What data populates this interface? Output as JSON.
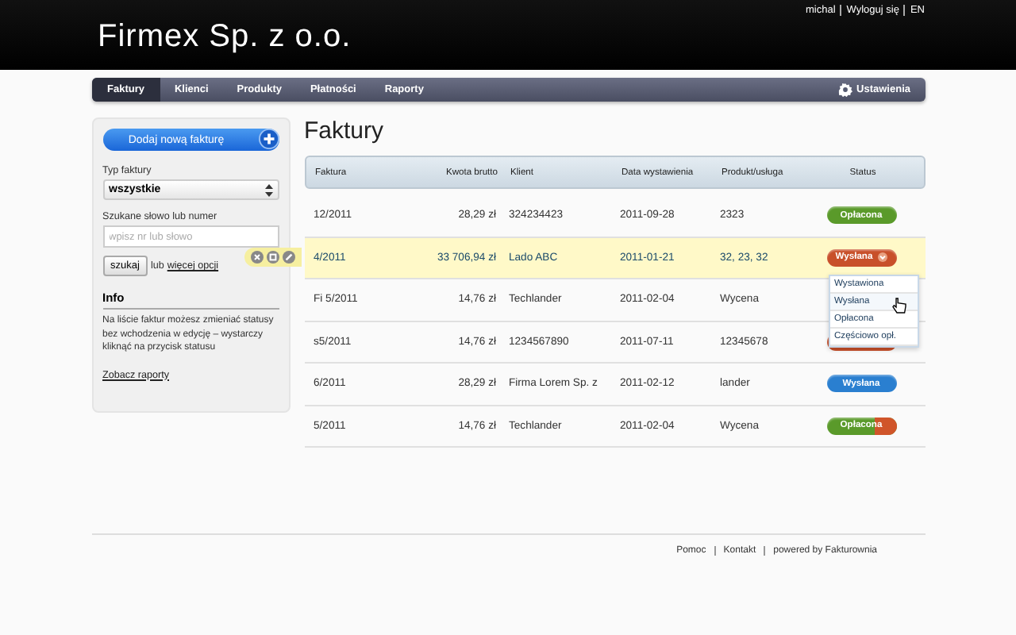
{
  "header": {
    "title": "Firmex Sp. z o.o.",
    "user_links": [
      "michal",
      "Wyloguj się",
      "EN"
    ]
  },
  "nav": {
    "items": [
      {
        "label": "Faktury",
        "selected": true
      },
      {
        "label": "Klienci",
        "selected": false
      },
      {
        "label": "Produkty",
        "selected": false
      },
      {
        "label": "Płatności",
        "selected": false
      },
      {
        "label": "Raporty",
        "selected": false
      }
    ],
    "settings": "Ustawienia"
  },
  "sidebar": {
    "add_button": "Dodaj nową fakturę",
    "type_label": "Typ faktury",
    "type_value": "wszystkie",
    "search_label": "Szukane słowo lub numer",
    "search_placeholder": "wpisz nr lub słowo",
    "search_button": "szukaj",
    "or_text": "lub",
    "more_link": "więcej opcji",
    "info_title": "Info",
    "info_text": "Na liście faktur możesz zmieniać statusy bez wchodzenia w edycję – wystarczy kliknąć na przycisk statusu",
    "report_link": "Zobacz raporty"
  },
  "main": {
    "title": "Faktury",
    "columns": [
      "Faktura",
      "Kwota brutto",
      "Klient",
      "Data wystawienia",
      "Produkt/usługa",
      "Status"
    ],
    "rows": [
      {
        "invoice": "12/2011",
        "amount": "28,29 zł",
        "client": "324234423",
        "date": "2011-09-28",
        "product": "2323",
        "highlighted": false,
        "status": {
          "label": "Opłacona",
          "color": "#5a9a2a"
        }
      },
      {
        "invoice": "4/2011",
        "amount": "33 706,94 zł",
        "client": "Lado ABC",
        "date": "2011-01-21",
        "product": "32, 23, 32",
        "highlighted": true,
        "status": {
          "label": "Wysłana",
          "color": "#c8502a",
          "open": true
        }
      },
      {
        "invoice": "Fi 5/2011",
        "amount": "14,76 zł",
        "client": "Techlander",
        "date": "2011-02-04",
        "product": "Wycena",
        "highlighted": false
      },
      {
        "invoice": "s5/2011",
        "amount": "14,76 zł",
        "client": "1234567890",
        "date": "2011-07-11",
        "product": "12345678",
        "highlighted": false,
        "status": {
          "color": "#c8502a"
        }
      },
      {
        "invoice": "6/2011",
        "amount": "28,29 zł",
        "client": "Firma Lorem Sp. z",
        "date": "2011-02-12",
        "product": "lander",
        "highlighted": false,
        "status": {
          "label": "Wysłana",
          "color": "#2a7fd0"
        }
      },
      {
        "invoice": "5/2011",
        "amount": "14,76 zł",
        "client": "Techlander",
        "date": "2011-02-04",
        "product": "Wycena",
        "highlighted": false,
        "status": {
          "label": "Opłacona",
          "color": "#5a9a2a",
          "partial": {
            "color": "#d0552a"
          }
        }
      }
    ],
    "status_menu": [
      {
        "label": "Wystawiona",
        "hovered": false
      },
      {
        "label": "Wysłana",
        "hovered": true
      },
      {
        "label": "Opłacona",
        "hovered": false
      },
      {
        "label": "Częściowo opł.",
        "hovered": false
      }
    ]
  },
  "footer": [
    "Pomoc",
    "Kontakt",
    "powered by Fakturownia"
  ]
}
